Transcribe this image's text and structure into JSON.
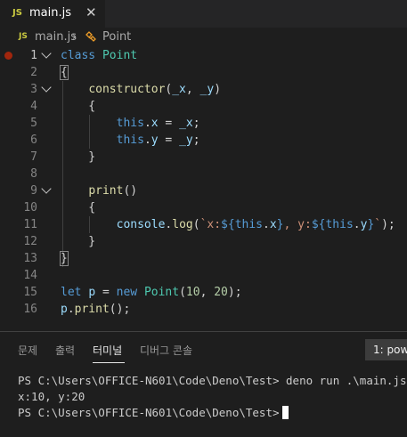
{
  "tab": {
    "icon": "JS",
    "label": "main.js"
  },
  "breadcrumb": {
    "icon": "JS",
    "file": "main.js",
    "separator": "›",
    "symbol": "Point"
  },
  "editor": {
    "lines": [
      {
        "n": "1",
        "tokens": [
          [
            "kw",
            "class"
          ],
          [
            "plain",
            " "
          ],
          [
            "cls",
            "Point"
          ]
        ]
      },
      {
        "n": "2",
        "tokens": [
          [
            "box",
            "{"
          ]
        ]
      },
      {
        "n": "3",
        "tokens": [
          [
            "plain",
            "    "
          ],
          [
            "fn",
            "constructor"
          ],
          [
            "plain",
            "("
          ],
          [
            "var",
            "_x"
          ],
          [
            "plain",
            ", "
          ],
          [
            "var",
            "_y"
          ],
          [
            "plain",
            ")"
          ]
        ]
      },
      {
        "n": "4",
        "tokens": [
          [
            "plain",
            "    {"
          ]
        ]
      },
      {
        "n": "5",
        "tokens": [
          [
            "plain",
            "        "
          ],
          [
            "kw",
            "this"
          ],
          [
            "plain",
            "."
          ],
          [
            "var",
            "x"
          ],
          [
            "plain",
            " = "
          ],
          [
            "var",
            "_x"
          ],
          [
            "plain",
            ";"
          ]
        ]
      },
      {
        "n": "6",
        "tokens": [
          [
            "plain",
            "        "
          ],
          [
            "kw",
            "this"
          ],
          [
            "plain",
            "."
          ],
          [
            "var",
            "y"
          ],
          [
            "plain",
            " = "
          ],
          [
            "var",
            "_y"
          ],
          [
            "plain",
            ";"
          ]
        ]
      },
      {
        "n": "7",
        "tokens": [
          [
            "plain",
            "    }"
          ]
        ]
      },
      {
        "n": "8",
        "tokens": []
      },
      {
        "n": "9",
        "tokens": [
          [
            "plain",
            "    "
          ],
          [
            "fn",
            "print"
          ],
          [
            "plain",
            "()"
          ]
        ]
      },
      {
        "n": "10",
        "tokens": [
          [
            "plain",
            "    {"
          ]
        ]
      },
      {
        "n": "11",
        "tokens": [
          [
            "plain",
            "        "
          ],
          [
            "var",
            "console"
          ],
          [
            "plain",
            "."
          ],
          [
            "fn",
            "log"
          ],
          [
            "plain",
            "("
          ],
          [
            "str",
            "`x:"
          ],
          [
            "tpl",
            "${"
          ],
          [
            "kw",
            "this"
          ],
          [
            "plain",
            "."
          ],
          [
            "var",
            "x"
          ],
          [
            "tpl",
            "}"
          ],
          [
            "str",
            ", y:"
          ],
          [
            "tpl",
            "${"
          ],
          [
            "kw",
            "this"
          ],
          [
            "plain",
            "."
          ],
          [
            "var",
            "y"
          ],
          [
            "tpl",
            "}"
          ],
          [
            "str",
            "`"
          ],
          [
            "plain",
            ");"
          ]
        ]
      },
      {
        "n": "12",
        "tokens": [
          [
            "plain",
            "    }"
          ]
        ]
      },
      {
        "n": "13",
        "tokens": [
          [
            "box",
            "}"
          ]
        ]
      },
      {
        "n": "14",
        "tokens": []
      },
      {
        "n": "15",
        "tokens": [
          [
            "kw",
            "let"
          ],
          [
            "plain",
            " "
          ],
          [
            "var",
            "p"
          ],
          [
            "plain",
            " = "
          ],
          [
            "kw",
            "new"
          ],
          [
            "plain",
            " "
          ],
          [
            "cls",
            "Point"
          ],
          [
            "plain",
            "("
          ],
          [
            "num",
            "10"
          ],
          [
            "plain",
            ", "
          ],
          [
            "num",
            "20"
          ],
          [
            "plain",
            ");"
          ]
        ]
      },
      {
        "n": "16",
        "tokens": [
          [
            "var",
            "p"
          ],
          [
            "plain",
            "."
          ],
          [
            "fn",
            "print"
          ],
          [
            "plain",
            "();"
          ]
        ]
      }
    ]
  },
  "panel": {
    "tabs": [
      "문제",
      "출력",
      "터미널",
      "디버그 콘솔"
    ],
    "active_tab": "터미널",
    "terminal_select": "1: pow",
    "terminal_lines": [
      "PS C:\\Users\\OFFICE-N601\\Code\\Deno\\Test> deno run .\\main.js",
      "x:10, y:20",
      "PS C:\\Users\\OFFICE-N601\\Code\\Deno\\Test>"
    ]
  }
}
